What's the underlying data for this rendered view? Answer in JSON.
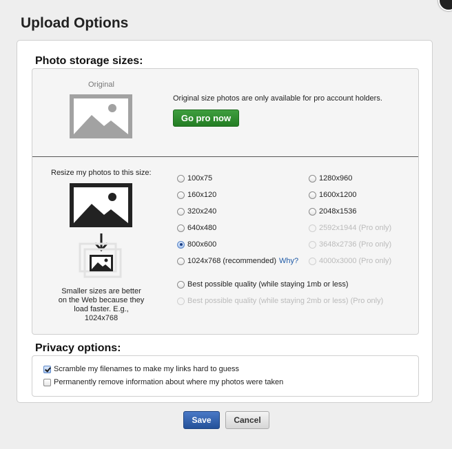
{
  "dialog": {
    "title": "Upload Options"
  },
  "storage": {
    "heading": "Photo storage sizes:",
    "original_caption": "Original",
    "pro_text": "Original size photos are only available for pro account holders.",
    "go_pro_label": "Go pro now",
    "resize_label": "Resize my photos to this size:",
    "help_text": "Smaller sizes are better on the Web because they load faster. E.g., 1024x768",
    "why_link": "Why?",
    "selected": "800x600",
    "options_left": [
      {
        "label": "100x75",
        "disabled": false
      },
      {
        "label": "160x120",
        "disabled": false
      },
      {
        "label": "320x240",
        "disabled": false
      },
      {
        "label": "640x480",
        "disabled": false
      },
      {
        "label": "800x600",
        "disabled": false
      },
      {
        "label": "1024x768 (recommended)",
        "disabled": false
      }
    ],
    "options_right": [
      {
        "label": "1280x960",
        "disabled": false
      },
      {
        "label": "1600x1200",
        "disabled": false
      },
      {
        "label": "2048x1536",
        "disabled": false
      },
      {
        "label": "2592x1944 (Pro only)",
        "disabled": true
      },
      {
        "label": "3648x2736 (Pro only)",
        "disabled": true
      },
      {
        "label": "4000x3000 (Pro only)",
        "disabled": true
      }
    ],
    "quality_options": [
      {
        "label": "Best possible quality (while staying 1mb or less)",
        "disabled": false
      },
      {
        "label": "Best possible quality (while staying 2mb or less) (Pro only)",
        "disabled": true
      }
    ]
  },
  "privacy": {
    "heading": "Privacy options:",
    "options": [
      {
        "label": "Scramble my filenames to make my links hard to guess",
        "checked": true
      },
      {
        "label": "Permanently remove information about where my photos were taken",
        "checked": false
      }
    ]
  },
  "buttons": {
    "save": "Save",
    "cancel": "Cancel"
  },
  "colors": {
    "primary": "#245199",
    "go_pro": "#2a862a",
    "link": "#1f5aa6"
  }
}
